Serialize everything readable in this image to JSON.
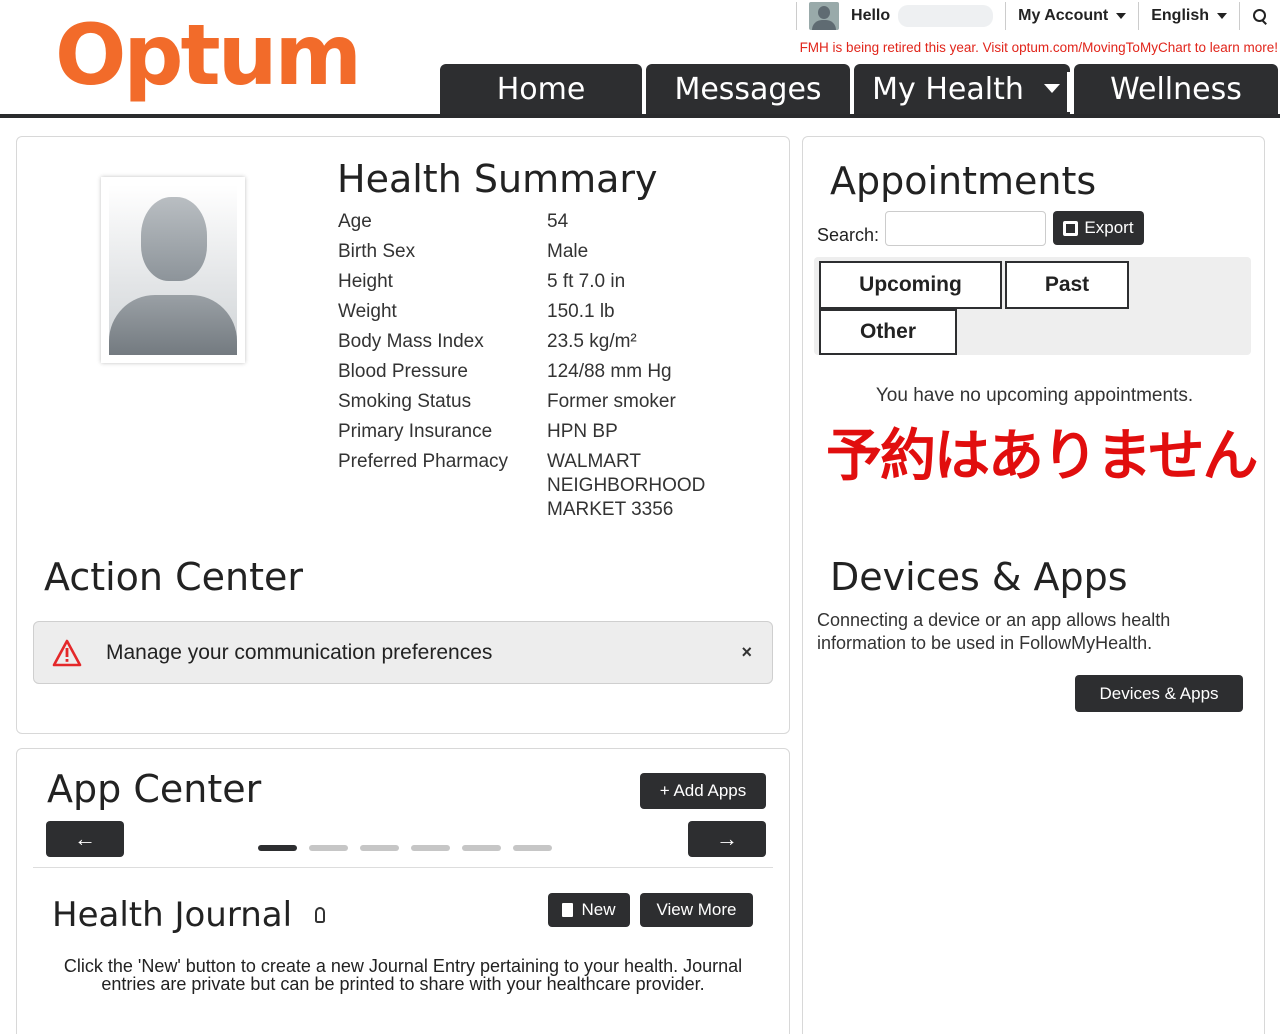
{
  "brand": {
    "logo_text": "Optum",
    "accent": "#f26b2a"
  },
  "topbar": {
    "greeting": "Hello",
    "my_account": "My Account",
    "language": "English",
    "search_icon": "search-icon"
  },
  "notice": "FMH is being retired this year. Visit optum.com/MovingToMyChart to learn more!",
  "nav": {
    "tabs": [
      {
        "label": "Home"
      },
      {
        "label": "Messages"
      },
      {
        "label": "My Health"
      },
      {
        "label": "Wellness"
      }
    ]
  },
  "health_summary": {
    "title": "Health Summary",
    "rows": [
      {
        "key": "Age",
        "value": "54"
      },
      {
        "key": "Birth Sex",
        "value": "Male"
      },
      {
        "key": "Height",
        "value": "5 ft 7.0 in"
      },
      {
        "key": "Weight",
        "value": "150.1 lb"
      },
      {
        "key": "Body Mass Index",
        "value": "23.5 kg/m²"
      },
      {
        "key": "Blood Pressure",
        "value": "124/88 mm Hg"
      },
      {
        "key": "Smoking Status",
        "value": "Former smoker"
      },
      {
        "key": "Primary Insurance",
        "value": "HPN BP"
      },
      {
        "key": "Preferred Pharmacy",
        "value": "WALMART NEIGHBORHOOD MARKET 3356"
      }
    ]
  },
  "action_center": {
    "title": "Action Center",
    "alert_text": "Manage your communication preferences",
    "close_glyph": "×"
  },
  "app_center": {
    "title": "App Center",
    "add_apps_label": "+ Add Apps",
    "left_arrow": "←",
    "right_arrow": "→",
    "carousel_dots": 6,
    "active_dot": 0
  },
  "health_journal": {
    "title": "Health Journal",
    "new_label": "New",
    "view_more_label": "View More",
    "description": "Click the 'New' button to create a new Journal Entry pertaining to your health. Journal entries are private but can be printed to share with your healthcare provider."
  },
  "appointments": {
    "title": "Appointments",
    "search_label": "Search:",
    "search_value": "",
    "export_label": "Export",
    "tabs": [
      {
        "label": "Upcoming"
      },
      {
        "label": "Past"
      },
      {
        "label": "Other"
      }
    ],
    "empty_message": "You have no upcoming appointments.",
    "annotation_jp": "予約はありません"
  },
  "devices_apps": {
    "title": "Devices & Apps",
    "description": "Connecting a device or an app allows health information to be used in FollowMyHealth.",
    "button_label": "Devices & Apps"
  }
}
